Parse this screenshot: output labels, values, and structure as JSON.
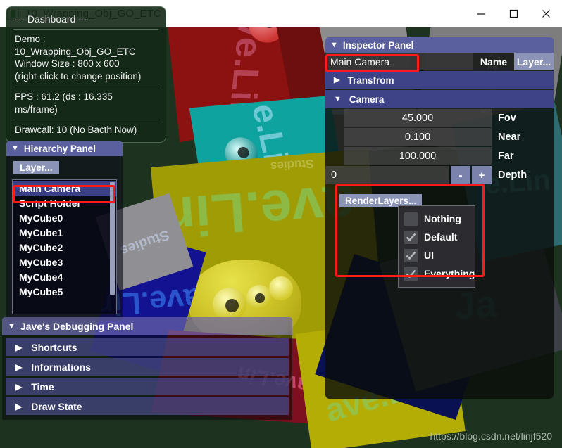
{
  "window": {
    "title": "10_Wrapping_Obj_GO_ETC",
    "app_icon": "app-window-icon",
    "minimize_label": "minimize-icon",
    "maximize_label": "maximize-icon",
    "close_label": "close-icon"
  },
  "dashboard": {
    "title": "--- Dashboard ---",
    "demo_line": "Demo : 10_Wrapping_Obj_GO_ETC",
    "window_size_line": "Window Size : 800 x 600",
    "hint_line": "(right-click to change position)",
    "fps_line": "FPS : 61.2 (ds : 16.335 ms/frame)",
    "drawcall_line": "Drawcall: 10 (No Bacth Now)"
  },
  "hierarchy": {
    "header": "Hierarchy Panel",
    "header_arrow": "▼",
    "layer_button": "Layer...",
    "items": [
      {
        "label": "Main Camera",
        "selected": true
      },
      {
        "label": "Script Holder",
        "selected": false
      },
      {
        "label": "MyCube0",
        "selected": false
      },
      {
        "label": "MyCube1",
        "selected": false
      },
      {
        "label": "MyCube2",
        "selected": false
      },
      {
        "label": "MyCube3",
        "selected": false
      },
      {
        "label": "MyCube4",
        "selected": false
      },
      {
        "label": "MyCube5",
        "selected": false
      }
    ]
  },
  "inspector": {
    "header": "Inspector Panel",
    "header_arrow": "▼",
    "name_value": "Main Camera",
    "name_label": "Name",
    "layer_button": "Layer...",
    "transform_foldout": "Transfrom",
    "transform_arrow": "▶",
    "camera_foldout": "Camera",
    "camera_arrow": "▼",
    "properties": [
      {
        "value": "45.000",
        "name": "Fov"
      },
      {
        "value": "0.100",
        "name": "Near"
      },
      {
        "value": "100.000",
        "name": "Far"
      }
    ],
    "depth": {
      "value": "0",
      "name": "Depth",
      "minus": "-",
      "plus": "+"
    },
    "render_layers": {
      "button": "RenderLayers...",
      "options": [
        {
          "label": "Nothing",
          "checked": false
        },
        {
          "label": "Default",
          "checked": true
        },
        {
          "label": "UI",
          "checked": true
        },
        {
          "label": "Everything",
          "checked": true
        }
      ]
    }
  },
  "debug_panel": {
    "header": "Jave's Debugging Panel",
    "header_arrow": "▼",
    "rows": [
      {
        "label": "Shortcuts",
        "arrow": "▶"
      },
      {
        "label": "Informations",
        "arrow": "▶"
      },
      {
        "label": "Time",
        "arrow": "▶"
      },
      {
        "label": "Draw State",
        "arrow": "▶"
      }
    ]
  },
  "scene": {
    "watermark": "https://blog.csdn.net/linjf520",
    "background_color": "#1d3320",
    "cube_texture_text": "ave.Lin",
    "cube_texture_sub": "Studies",
    "cubes": [
      {
        "color": "#8b1111",
        "label": "ave.Lin"
      },
      {
        "color": "#0f9a99",
        "label": "e.Lin"
      },
      {
        "color": "#9a9a00",
        "label": "ave.Lin"
      },
      {
        "color": "#0d1a8e",
        "label": "ave.Lin"
      },
      {
        "color": "#8a8a8a",
        "label": "e.Lin"
      },
      {
        "color": "#b3b300",
        "label": "ave.Lin"
      }
    ]
  },
  "theme": {
    "panel_header": "#5a5f9e",
    "foldout": "#3e4387",
    "highlight": "#ff1a1a",
    "button": "#8b93b6",
    "selection": "#3a3f86"
  }
}
